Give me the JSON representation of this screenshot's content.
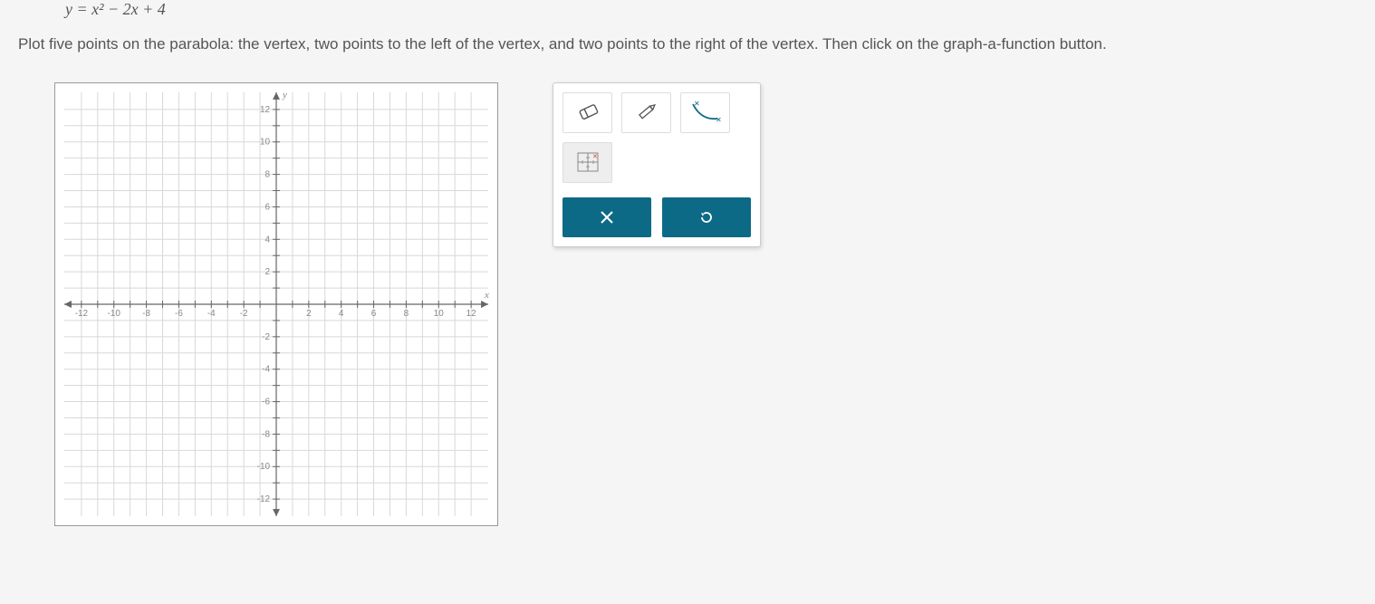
{
  "equation": "y = x² − 2x + 4",
  "instructions": "Plot five points on the parabola: the vertex, two points to the left of the vertex, and two points to the right of the vertex. Then click on the graph-a-function button.",
  "chart_data": {
    "type": "scatter",
    "title": "",
    "xlabel": "x",
    "ylabel": "y",
    "xlim": [
      -13,
      13
    ],
    "ylim": [
      -13,
      13
    ],
    "xticks": [
      -12,
      -10,
      -8,
      -6,
      -4,
      -2,
      2,
      4,
      6,
      8,
      10,
      12
    ],
    "yticks": [
      -12,
      -10,
      -8,
      -6,
      -4,
      -2,
      2,
      4,
      6,
      8,
      10,
      12
    ],
    "grid": true,
    "series": []
  },
  "tools": {
    "eraser": "eraser-icon",
    "pencil": "pencil-icon",
    "curve": "graph-a-function-icon",
    "point": "point-plot-icon"
  },
  "actions": {
    "clear_label": "×",
    "reset_label": "↺"
  }
}
